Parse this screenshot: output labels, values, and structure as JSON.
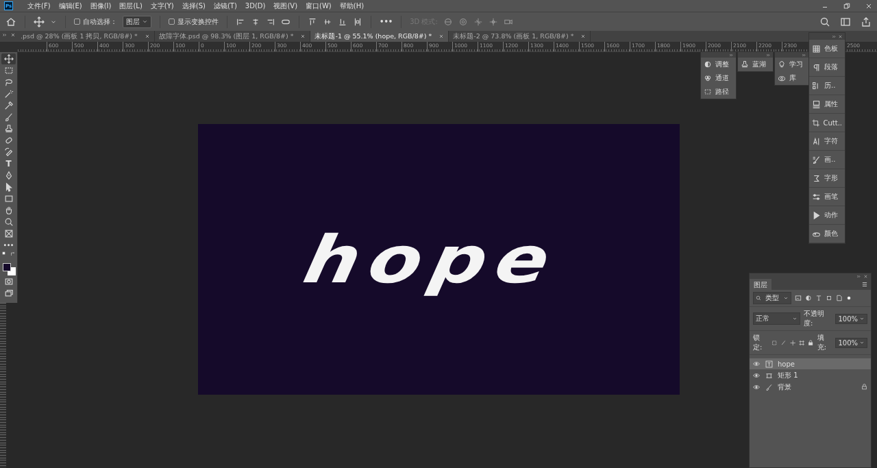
{
  "app_logo": "Ps",
  "menu": [
    "文件(F)",
    "编辑(E)",
    "图像(I)",
    "图层(L)",
    "文字(Y)",
    "选择(S)",
    "滤镜(T)",
    "3D(D)",
    "视图(V)",
    "窗口(W)",
    "帮助(H)"
  ],
  "options_bar": {
    "auto_select": {
      "label": "自动选择：",
      "checked": false
    },
    "auto_select_target": "图层",
    "transform_controls": {
      "label": "显示变换控件",
      "checked": false
    },
    "more": "•••",
    "mode_3d": {
      "label": "3D 模式:",
      "disabled": true
    }
  },
  "tabs": [
    {
      "label": ".psd @ 28% (画板 1 拷贝, RGB/8#) *",
      "selected": false
    },
    {
      "label": "故障字体.psd @ 98.3% (图层 1, RGB/8#) *",
      "selected": false
    },
    {
      "label": "未标题-1 @ 55.1% (hope, RGB/8#) *",
      "selected": true
    },
    {
      "label": "未标题-2 @ 73.8% (画板 1, RGB/8#) *",
      "selected": false
    }
  ],
  "ruler": {
    "labels": [
      "600",
      "500",
      "400",
      "300",
      "200",
      "100",
      "0",
      "100",
      "200",
      "300",
      "400",
      "500",
      "600",
      "700",
      "800",
      "900",
      "1000",
      "1100",
      "1200",
      "1300",
      "1400",
      "1500",
      "1600",
      "1700",
      "1800",
      "1900",
      "2000",
      "2100",
      "2200",
      "2300"
    ],
    "end_label": "2500"
  },
  "tools": [
    {
      "selected": true
    },
    {
      "selected": false
    },
    {
      "selected": false
    },
    {
      "selected": false
    },
    {
      "selected": false
    },
    {
      "selected": false
    },
    {
      "selected": false
    },
    {
      "selected": false
    },
    {
      "selected": false
    },
    {
      "selected": false,
      "glyph": "T"
    },
    {
      "selected": false
    },
    {
      "selected": false
    },
    {
      "selected": false
    },
    {
      "selected": false
    },
    {
      "selected": false
    },
    {
      "selected": false
    },
    {
      "selected": false,
      "glyph": "•••"
    }
  ],
  "canvas": {
    "text": "hope"
  },
  "panel_groups": [
    [
      {
        "label": "调整"
      },
      {
        "label": "通道"
      },
      {
        "label": "路径"
      }
    ],
    [
      {
        "label": "蓝湖"
      }
    ],
    [
      {
        "label": "学习"
      },
      {
        "label": "库"
      }
    ]
  ],
  "dock": [
    {
      "label": "色板"
    },
    {
      "label": "段落"
    },
    {
      "label": "历.."
    },
    {
      "label": "属性"
    },
    {
      "label": "Cutt.."
    },
    {
      "label": "字符"
    },
    {
      "label": "画.."
    },
    {
      "label": "字形"
    },
    {
      "label": "画笔"
    },
    {
      "label": "动作"
    },
    {
      "label": "颜色"
    }
  ],
  "layers_panel": {
    "title": "图层",
    "filter": "类型",
    "blend_mode": "正常",
    "opacity_label": "不透明度:",
    "opacity": "100%",
    "lock_label": "锁定:",
    "fill_label": "填充:",
    "fill": "100%",
    "layers": [
      {
        "name": "hope",
        "kind": "text",
        "visible": true,
        "selected": true,
        "locked": false
      },
      {
        "name": "矩形 1",
        "kind": "shape",
        "visible": true,
        "selected": false,
        "locked": false
      },
      {
        "name": "背景",
        "kind": "image",
        "visible": true,
        "selected": false,
        "locked": true
      }
    ]
  }
}
